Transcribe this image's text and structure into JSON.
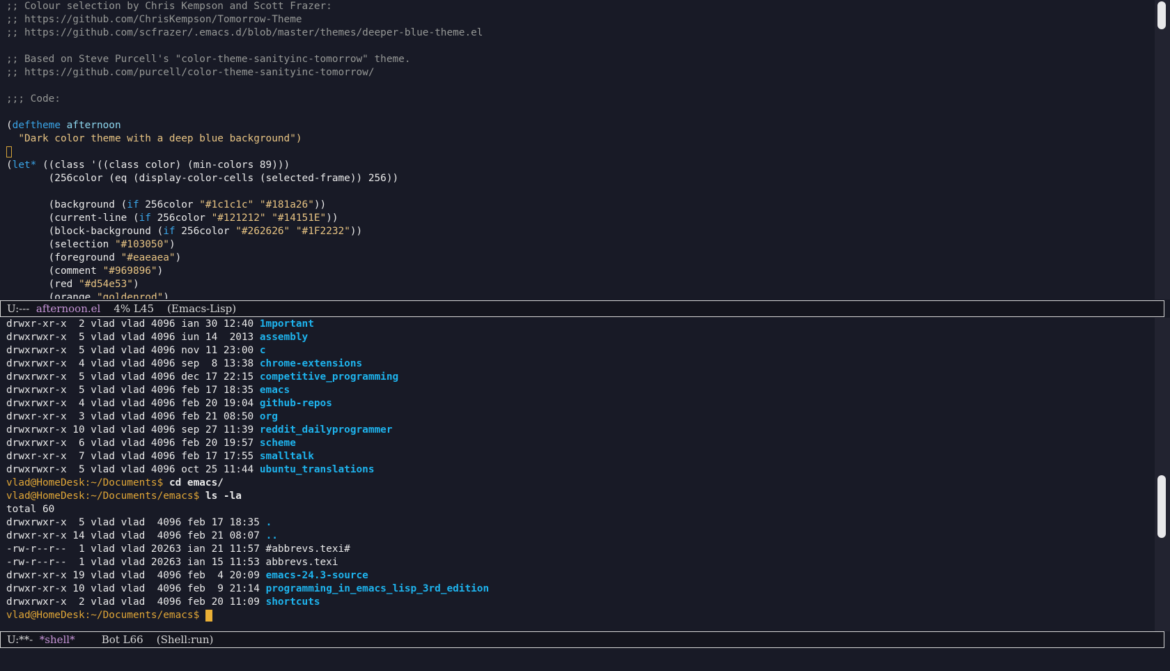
{
  "editor": {
    "lines": [
      {
        "type": "comment",
        "text": ";; Colour selection by Chris Kempson and Scott Frazer:"
      },
      {
        "type": "comment",
        "text": ";; https://github.com/ChrisKempson/Tomorrow-Theme"
      },
      {
        "type": "comment",
        "text": ";; https://github.com/scfrazer/.emacs.d/blob/master/themes/deeper-blue-theme.el"
      },
      {
        "type": "blank",
        "text": ""
      },
      {
        "type": "comment",
        "text": ";; Based on Steve Purcell's \"color-theme-sanityinc-tomorrow\" theme."
      },
      {
        "type": "comment",
        "text": ";; https://github.com/purcell/color-theme-sanityinc-tomorrow/"
      },
      {
        "type": "blank",
        "text": ""
      },
      {
        "type": "comment",
        "text": ";;; Code:"
      },
      {
        "type": "blank",
        "text": ""
      },
      {
        "type": "deftheme",
        "paren": "(",
        "kw": "deftheme",
        "name": " afternoon"
      },
      {
        "type": "string",
        "text": "  \"Dark color theme with a deep blue background\")"
      },
      {
        "type": "cursor"
      },
      {
        "type": "let",
        "paren": "(",
        "kw": "let*",
        "rest": " ((class '((class color) (min-colors 89)))"
      },
      {
        "type": "plain",
        "text": "       (256color (eq (display-color-cells (selected-frame)) 256))"
      },
      {
        "type": "blank",
        "text": ""
      },
      {
        "type": "ifpair",
        "pre": "       (background (",
        "kw": "if",
        "mid": " 256color ",
        "s1": "\"#1c1c1c\"",
        "s2": "\"#181a26\"",
        "post": "))"
      },
      {
        "type": "ifpair",
        "pre": "       (current-line (",
        "kw": "if",
        "mid": " 256color ",
        "s1": "\"#121212\"",
        "s2": "\"#14151E\"",
        "post": "))"
      },
      {
        "type": "ifpair",
        "pre": "       (block-background (",
        "kw": "if",
        "mid": " 256color ",
        "s1": "\"#262626\"",
        "s2": "\"#1F2232\"",
        "post": "))"
      },
      {
        "type": "pair",
        "pre": "       (selection ",
        "s1": "\"#103050\"",
        "post": ")"
      },
      {
        "type": "pair",
        "pre": "       (foreground ",
        "s1": "\"#eaeaea\"",
        "post": ")"
      },
      {
        "type": "pair",
        "pre": "       (comment ",
        "s1": "\"#969896\"",
        "post": ")"
      },
      {
        "type": "pair",
        "pre": "       (red ",
        "s1": "\"#d54e53\"",
        "post": ")"
      },
      {
        "type": "pair",
        "pre": "       (orange ",
        "s1": "\"goldenrod\"",
        "post": ")"
      }
    ]
  },
  "editor_modeline": {
    "status": "U:---  ",
    "buffer": "afternoon.el",
    "position": "    4% L45    ",
    "mode": "(Emacs-Lisp)"
  },
  "shell": {
    "lines": [
      {
        "type": "ls",
        "meta": "drwxr-xr-x  2 vlad vlad 4096 ian 30 12:40 ",
        "name": "1mportant"
      },
      {
        "type": "ls",
        "meta": "drwxrwxr-x  5 vlad vlad 4096 iun 14  2013 ",
        "name": "assembly"
      },
      {
        "type": "ls",
        "meta": "drwxrwxr-x  5 vlad vlad 4096 nov 11 23:00 ",
        "name": "c"
      },
      {
        "type": "ls",
        "meta": "drwxrwxr-x  4 vlad vlad 4096 sep  8 13:38 ",
        "name": "chrome-extensions"
      },
      {
        "type": "ls",
        "meta": "drwxrwxr-x  5 vlad vlad 4096 dec 17 22:15 ",
        "name": "competitive_programming"
      },
      {
        "type": "ls",
        "meta": "drwxrwxr-x  5 vlad vlad 4096 feb 17 18:35 ",
        "name": "emacs"
      },
      {
        "type": "ls",
        "meta": "drwxrwxr-x  4 vlad vlad 4096 feb 20 19:04 ",
        "name": "github-repos"
      },
      {
        "type": "ls",
        "meta": "drwxr-xr-x  3 vlad vlad 4096 feb 21 08:50 ",
        "name": "org"
      },
      {
        "type": "ls",
        "meta": "drwxrwxr-x 10 vlad vlad 4096 sep 27 11:39 ",
        "name": "reddit_dailyprogrammer"
      },
      {
        "type": "ls",
        "meta": "drwxrwxr-x  6 vlad vlad 4096 feb 20 19:57 ",
        "name": "scheme"
      },
      {
        "type": "ls",
        "meta": "drwxr-xr-x  7 vlad vlad 4096 feb 17 17:55 ",
        "name": "smalltalk"
      },
      {
        "type": "ls",
        "meta": "drwxrwxr-x  5 vlad vlad 4096 oct 25 11:44 ",
        "name": "ubuntu_translations"
      },
      {
        "type": "prompt",
        "prompt": "vlad@HomeDesk:~/Documents$ ",
        "cmd": "cd emacs/"
      },
      {
        "type": "prompt",
        "prompt": "vlad@HomeDesk:~/Documents/emacs$ ",
        "cmd": "ls -la"
      },
      {
        "type": "plain",
        "text": "total 60"
      },
      {
        "type": "ls",
        "meta": "drwxrwxr-x  5 vlad vlad  4096 feb 17 18:35 ",
        "name": "."
      },
      {
        "type": "ls",
        "meta": "drwxr-xr-x 14 vlad vlad  4096 feb 21 08:07 ",
        "name": ".."
      },
      {
        "type": "file",
        "text": "-rw-r--r--  1 vlad vlad 20263 ian 21 11:57 #abbrevs.texi#"
      },
      {
        "type": "file",
        "text": "-rw-r--r--  1 vlad vlad 20263 ian 15 11:53 abbrevs.texi"
      },
      {
        "type": "ls",
        "meta": "drwxr-xr-x 19 vlad vlad  4096 feb  4 20:09 ",
        "name": "emacs-24.3-source"
      },
      {
        "type": "ls",
        "meta": "drwxr-xr-x 10 vlad vlad  4096 feb  9 21:14 ",
        "name": "programming_in_emacs_lisp_3rd_edition"
      },
      {
        "type": "ls",
        "meta": "drwxrwxr-x  2 vlad vlad  4096 feb 20 11:09 ",
        "name": "shortcuts"
      },
      {
        "type": "finalprompt",
        "prompt": "vlad@HomeDesk:~/Documents/emacs$ "
      }
    ]
  },
  "shell_modeline": {
    "status": "U:**-  ",
    "buffer": "*shell*",
    "position": "        Bot L66    ",
    "mode": "(Shell:run)"
  },
  "colors": {
    "background": "#181a26",
    "foreground": "#eaeaea",
    "comment": "#969896",
    "keyword": "#3aa5e8",
    "string": "#e8c483",
    "directory": "#1eb4ee",
    "prompt": "#e0a637"
  }
}
